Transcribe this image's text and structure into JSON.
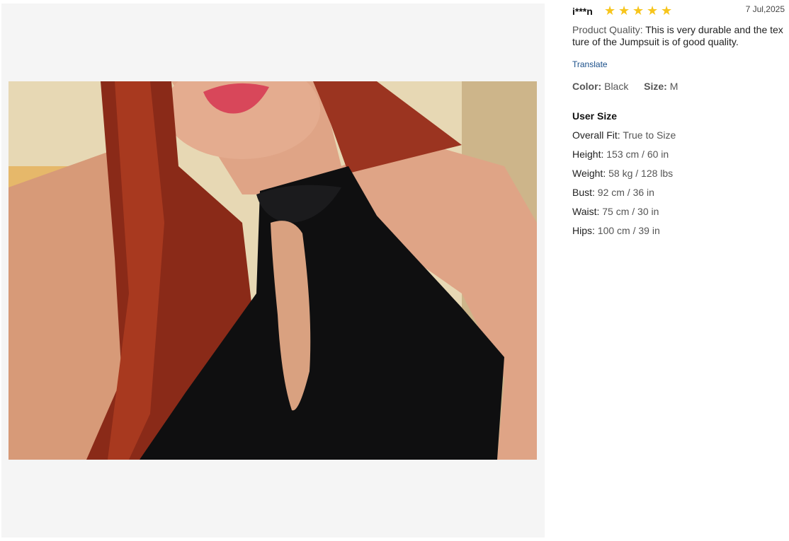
{
  "review": {
    "reviewer": "i***n",
    "rating": 5,
    "star_glyph": "★",
    "star_color": "#f7c51c",
    "date": "7 Jul,2025",
    "quality_label": "Product Quality:",
    "quality_text": "This is very durable and the texture of the Jumpsuit is of good quality.",
    "translate_label": "Translate",
    "color_label": "Color:",
    "color_value": "Black",
    "size_label": "Size:",
    "size_value": "M"
  },
  "user_size": {
    "title": "User Size",
    "items": [
      {
        "label": "Overall Fit:",
        "value": "True to Size"
      },
      {
        "label": "Height:",
        "value": "153 cm / 60 in"
      },
      {
        "label": "Weight:",
        "value": "58 kg / 128 lbs"
      },
      {
        "label": "Bust:",
        "value": "92 cm / 36 in"
      },
      {
        "label": "Waist:",
        "value": "75 cm / 30 in"
      },
      {
        "label": "Hips:",
        "value": "100 cm / 39 in"
      }
    ]
  },
  "colors": {
    "accent_link": "#1a4f8a",
    "viewer_bg": "#f5f5f5"
  }
}
